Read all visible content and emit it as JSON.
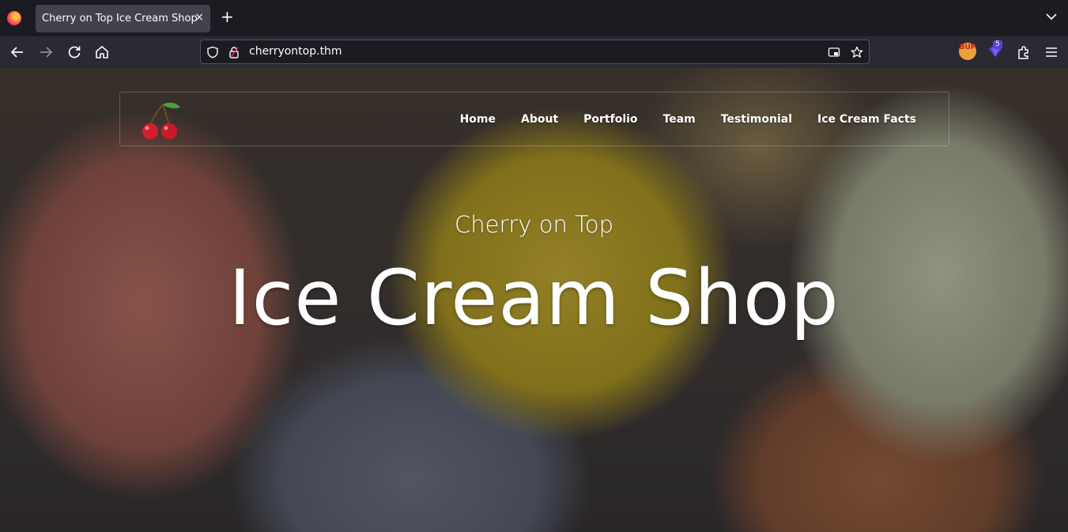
{
  "browser": {
    "tab_title": "Cherry on Top Ice Cream Shop",
    "tab_close": "×",
    "new_tab": "+",
    "url": "cherryontop.thm",
    "extensions": {
      "bup_label": "BUP",
      "badge_count": "5"
    },
    "colors": {
      "tabbar_bg": "#1c1b22",
      "navbar_bg": "#2b2a33",
      "tab_bg": "#42414d"
    }
  },
  "site": {
    "logo_icon": "cherry-icon",
    "nav": [
      {
        "label": "Home"
      },
      {
        "label": "About"
      },
      {
        "label": "Portfolio"
      },
      {
        "label": "Team"
      },
      {
        "label": "Testimonial"
      },
      {
        "label": "Ice Cream Facts"
      }
    ],
    "hero": {
      "subtitle": "Cherry on Top",
      "title": "Ice Cream Shop"
    }
  }
}
